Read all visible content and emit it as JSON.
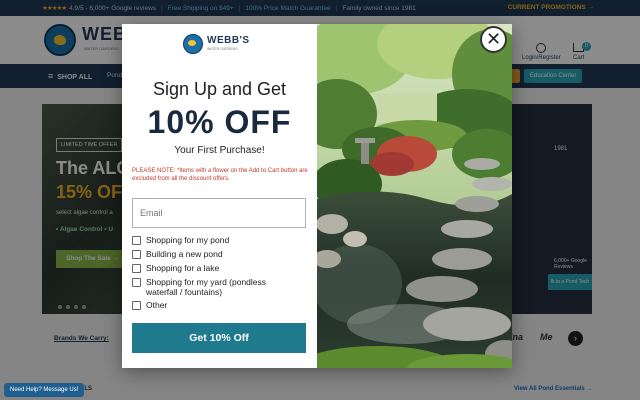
{
  "topbar": {
    "rating": "4.9/5 - 6,000+ Google reviews",
    "shipping": "Free Shipping on $49+",
    "price_match": "100% Price Match Guarantee",
    "family": "Family owned since 1981",
    "promotions": "CURRENT PROMOTIONS →"
  },
  "header": {
    "logo": "WEBB'S",
    "logo_sub": "WATER GARDENS",
    "login": "Login/Register",
    "cart": "Cart",
    "cart_count": "0"
  },
  "nav": {
    "shop_all": "SHOP ALL",
    "pond": "Pond",
    "education": "Education Center"
  },
  "hero": {
    "badge": "LIMITED TIME OFFER",
    "title_line1": "The ALG",
    "title_line2": "15% OF",
    "subtitle": "select algae control a",
    "links": "• Algae Control  • U",
    "cta": "Shop The Sale →",
    "side_title": "1981",
    "side_reviews": "6,000+ Google Reviews",
    "side_cta": "lk to a Pond Tech"
  },
  "brands": {
    "label": "Brands We Carry:",
    "brand_a": "ina",
    "brand_b": "Me"
  },
  "bottom": {
    "section": "ALS",
    "view_all": "View All Pond Essentials →",
    "help": "Need Help? Message Us!"
  },
  "modal": {
    "logo": "WEBB'S",
    "logo_sub": "WATER GARDENS",
    "headline": "Sign Up and Get",
    "offer": "10% OFF",
    "subhead": "Your First Purchase!",
    "note": "PLEASE NOTE: *Items with a flower on the Add to Cart button are excluded from all the discount offers.",
    "email_placeholder": "Email",
    "options": [
      "Shopping for my pond",
      "Building a new pond",
      "Shopping for a lake",
      "Shopping for my yard (pondless waterfall / fountains)",
      "Other"
    ],
    "submit": "Get 10% Off",
    "close": "✕"
  },
  "colors": {
    "navy": "#1f3a57",
    "teal_button": "#1e7a8c",
    "note_red": "#c0392b",
    "accent_gold": "#f0b429"
  }
}
